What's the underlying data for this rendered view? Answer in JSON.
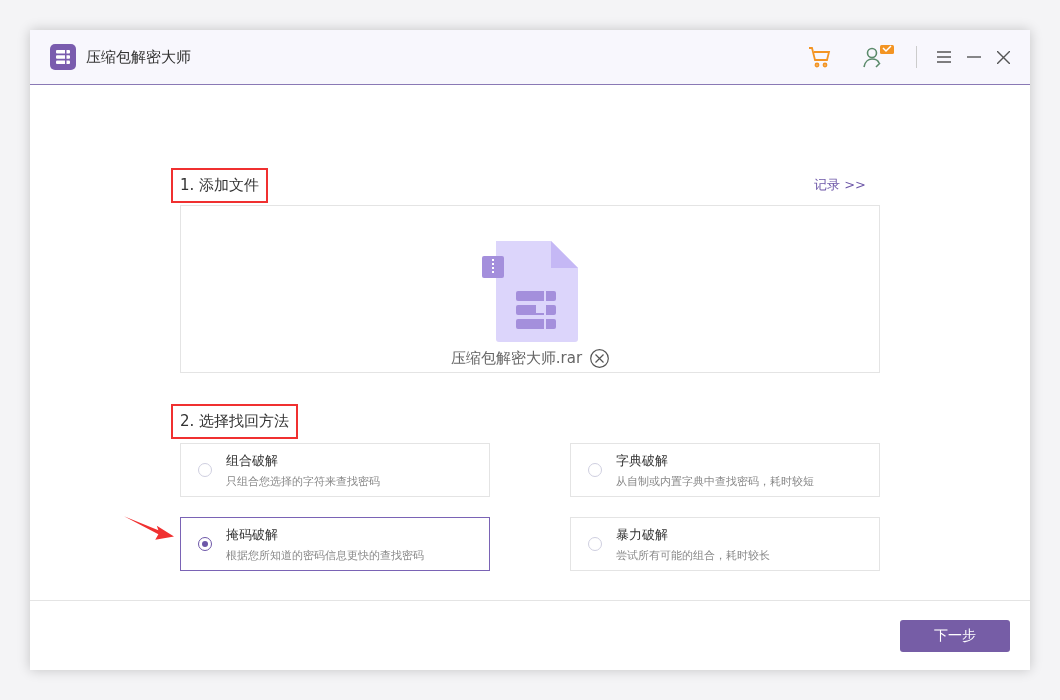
{
  "window": {
    "title": "压缩包解密大师"
  },
  "step1": {
    "title": "1. 添加文件",
    "highlighted": true,
    "history_link": "记录 >>",
    "file_name": "压缩包解密大师.rar"
  },
  "step2": {
    "title": "2. 选择找回方法",
    "highlighted": true,
    "methods": [
      {
        "name": "组合破解",
        "description": "只组合您选择的字符来查找密码",
        "selected": false
      },
      {
        "name": "字典破解",
        "description": "从自制或内置字典中查找密码，耗时较短",
        "selected": false
      },
      {
        "name": "掩码破解",
        "description": "根据您所知道的密码信息更快的查找密码",
        "selected": true
      },
      {
        "name": "暴力破解",
        "description": "尝试所有可能的组合，耗时较长",
        "selected": false
      }
    ]
  },
  "next_button": "下一步"
}
